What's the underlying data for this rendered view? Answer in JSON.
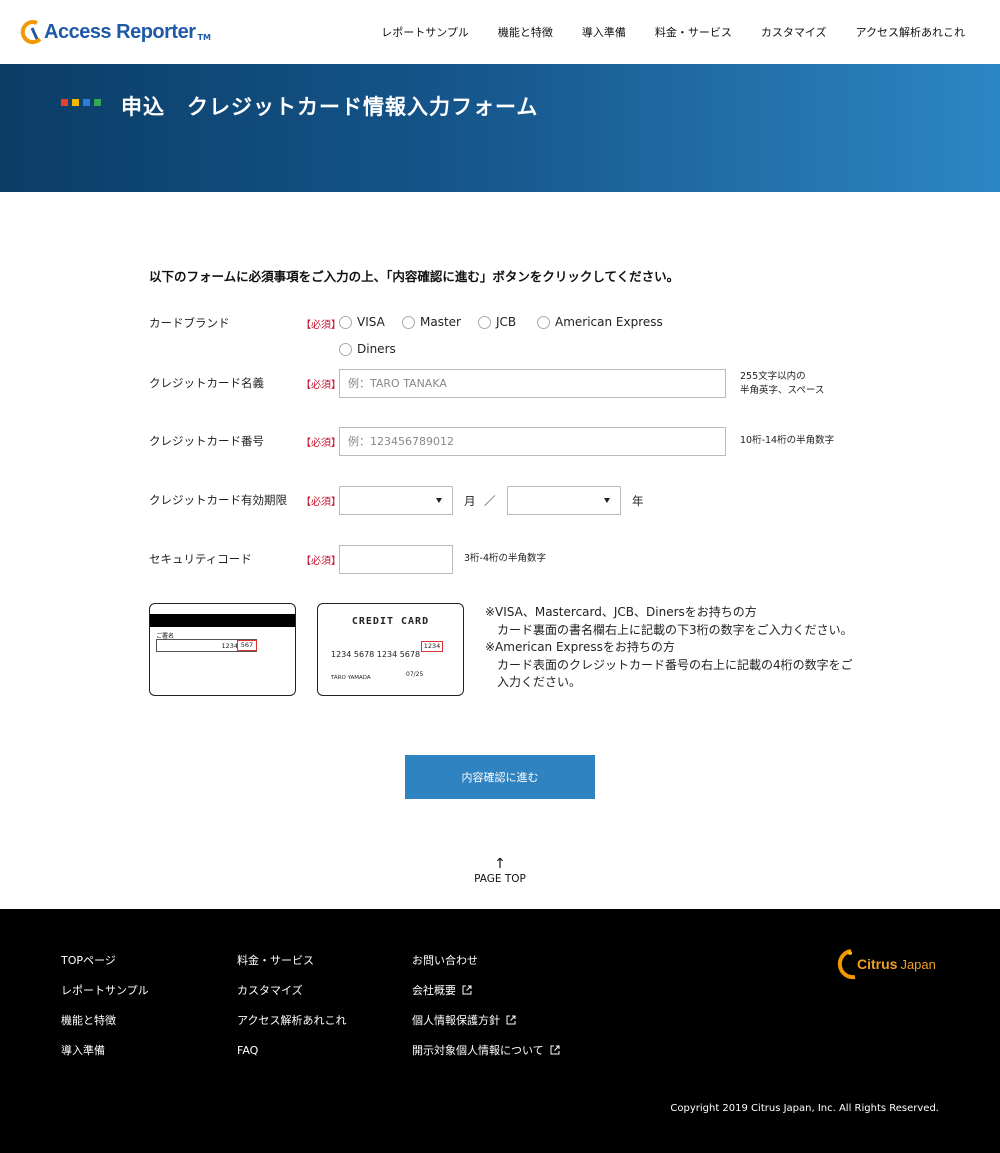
{
  "header": {
    "logo_part1": "Access",
    "logo_part2": "Reporter",
    "logo_tm": "TM",
    "nav": [
      "レポートサンプル",
      "機能と特徴",
      "導入準備",
      "料金・サービス",
      "カスタマイズ",
      "アクセス解析あれこれ"
    ]
  },
  "hero": {
    "title": "申込　クレジットカード情報入力フォーム",
    "dot_colors": [
      "#e8402f",
      "#f5b800",
      "#2a7fd4",
      "#35a853"
    ]
  },
  "form": {
    "intro": "以下のフォームに必須事項をご入力の上、「内容確認に進む」ボタンをクリックしてください。",
    "required_label": "【必須】",
    "brand": {
      "label": "カードブランド",
      "options": [
        "VISA",
        "Master",
        "JCB",
        "American Express",
        "Diners"
      ]
    },
    "name": {
      "label": "クレジットカード名義",
      "placeholder": "例：TARO TANAKA",
      "hint_line1": "255文字以内の",
      "hint_line2": "半角英字、スペース"
    },
    "number": {
      "label": "クレジットカード番号",
      "placeholder": "例：123456789012",
      "hint": "10桁-14桁の半角数字"
    },
    "expiry": {
      "label": "クレジットカード有効期限",
      "month_unit": "月",
      "separator": "／",
      "year_unit": "年"
    },
    "security": {
      "label": "セキュリティコード",
      "hint": "3桁-4桁の半角数字"
    },
    "card_back": {
      "sign_label": "ご署名",
      "sign_digits": "1234",
      "code": "567"
    },
    "card_front": {
      "title": "CREDIT CARD",
      "code": "1234",
      "number": "1234 5678 1234 5678",
      "holder": "TARO YAMADA",
      "expiry": "07/25"
    },
    "notes": {
      "line1": "※VISA、Mastercard、JCB、Dinersをお持ちの方",
      "line2": "カード裏面の書名欄右上に記載の下3桁の数字をご入力ください。",
      "line3": "※American Expressをお持ちの方",
      "line4": "カード表面のクレジットカード番号の右上に記載の4桁の数字をご入力ください。"
    },
    "submit_label": "内容確認に進む"
  },
  "pagetop": {
    "arrow": "↑",
    "label": "PAGE TOP"
  },
  "footer": {
    "col1": [
      "TOPページ",
      "レポートサンプル",
      "機能と特徴",
      "導入準備"
    ],
    "col2": [
      "料金・サービス",
      "カスタマイズ",
      "アクセス解析あれこれ",
      "FAQ"
    ],
    "col3": [
      "お問い合わせ",
      "会社概要",
      "個人情報保護方針",
      "開示対象個人情報について"
    ],
    "logo_part1": "Citrus",
    "logo_part2": "Japan",
    "copyright": "Copyright 2019 Citrus Japan, Inc. All Rights Reserved."
  }
}
